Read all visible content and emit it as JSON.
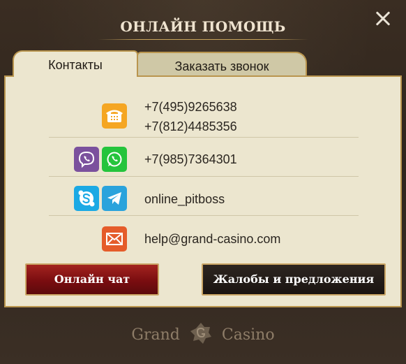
{
  "dialog": {
    "title": "ОНЛАЙН ПОМОЩЬ"
  },
  "tabs": [
    {
      "label": "Контакты",
      "active": true
    },
    {
      "label": "Заказать звонок",
      "active": false
    }
  ],
  "contacts": {
    "phones": [
      "+7(495)9265638",
      "+7(812)4485356"
    ],
    "messenger_phone": "+7(985)7364301",
    "username": "online_pitboss",
    "email": "help@grand-casino.com"
  },
  "icons": {
    "phone": {
      "name": "phone-icon",
      "color": "#f5a623"
    },
    "viber": {
      "name": "viber-icon",
      "color": "#7b519d"
    },
    "whatsapp": {
      "name": "whatsapp-icon",
      "color": "#25c43c"
    },
    "skype": {
      "name": "skype-icon",
      "color": "#1ba9e4"
    },
    "telegram": {
      "name": "telegram-icon",
      "color": "#2aa3dc"
    },
    "mail": {
      "name": "mail-icon",
      "color": "#e55c2a"
    }
  },
  "buttons": {
    "chat": "Онлайн чат",
    "complaints": "Жалобы и предложения"
  },
  "footer": {
    "logo_left": "Grand",
    "logo_right": "Casino"
  }
}
